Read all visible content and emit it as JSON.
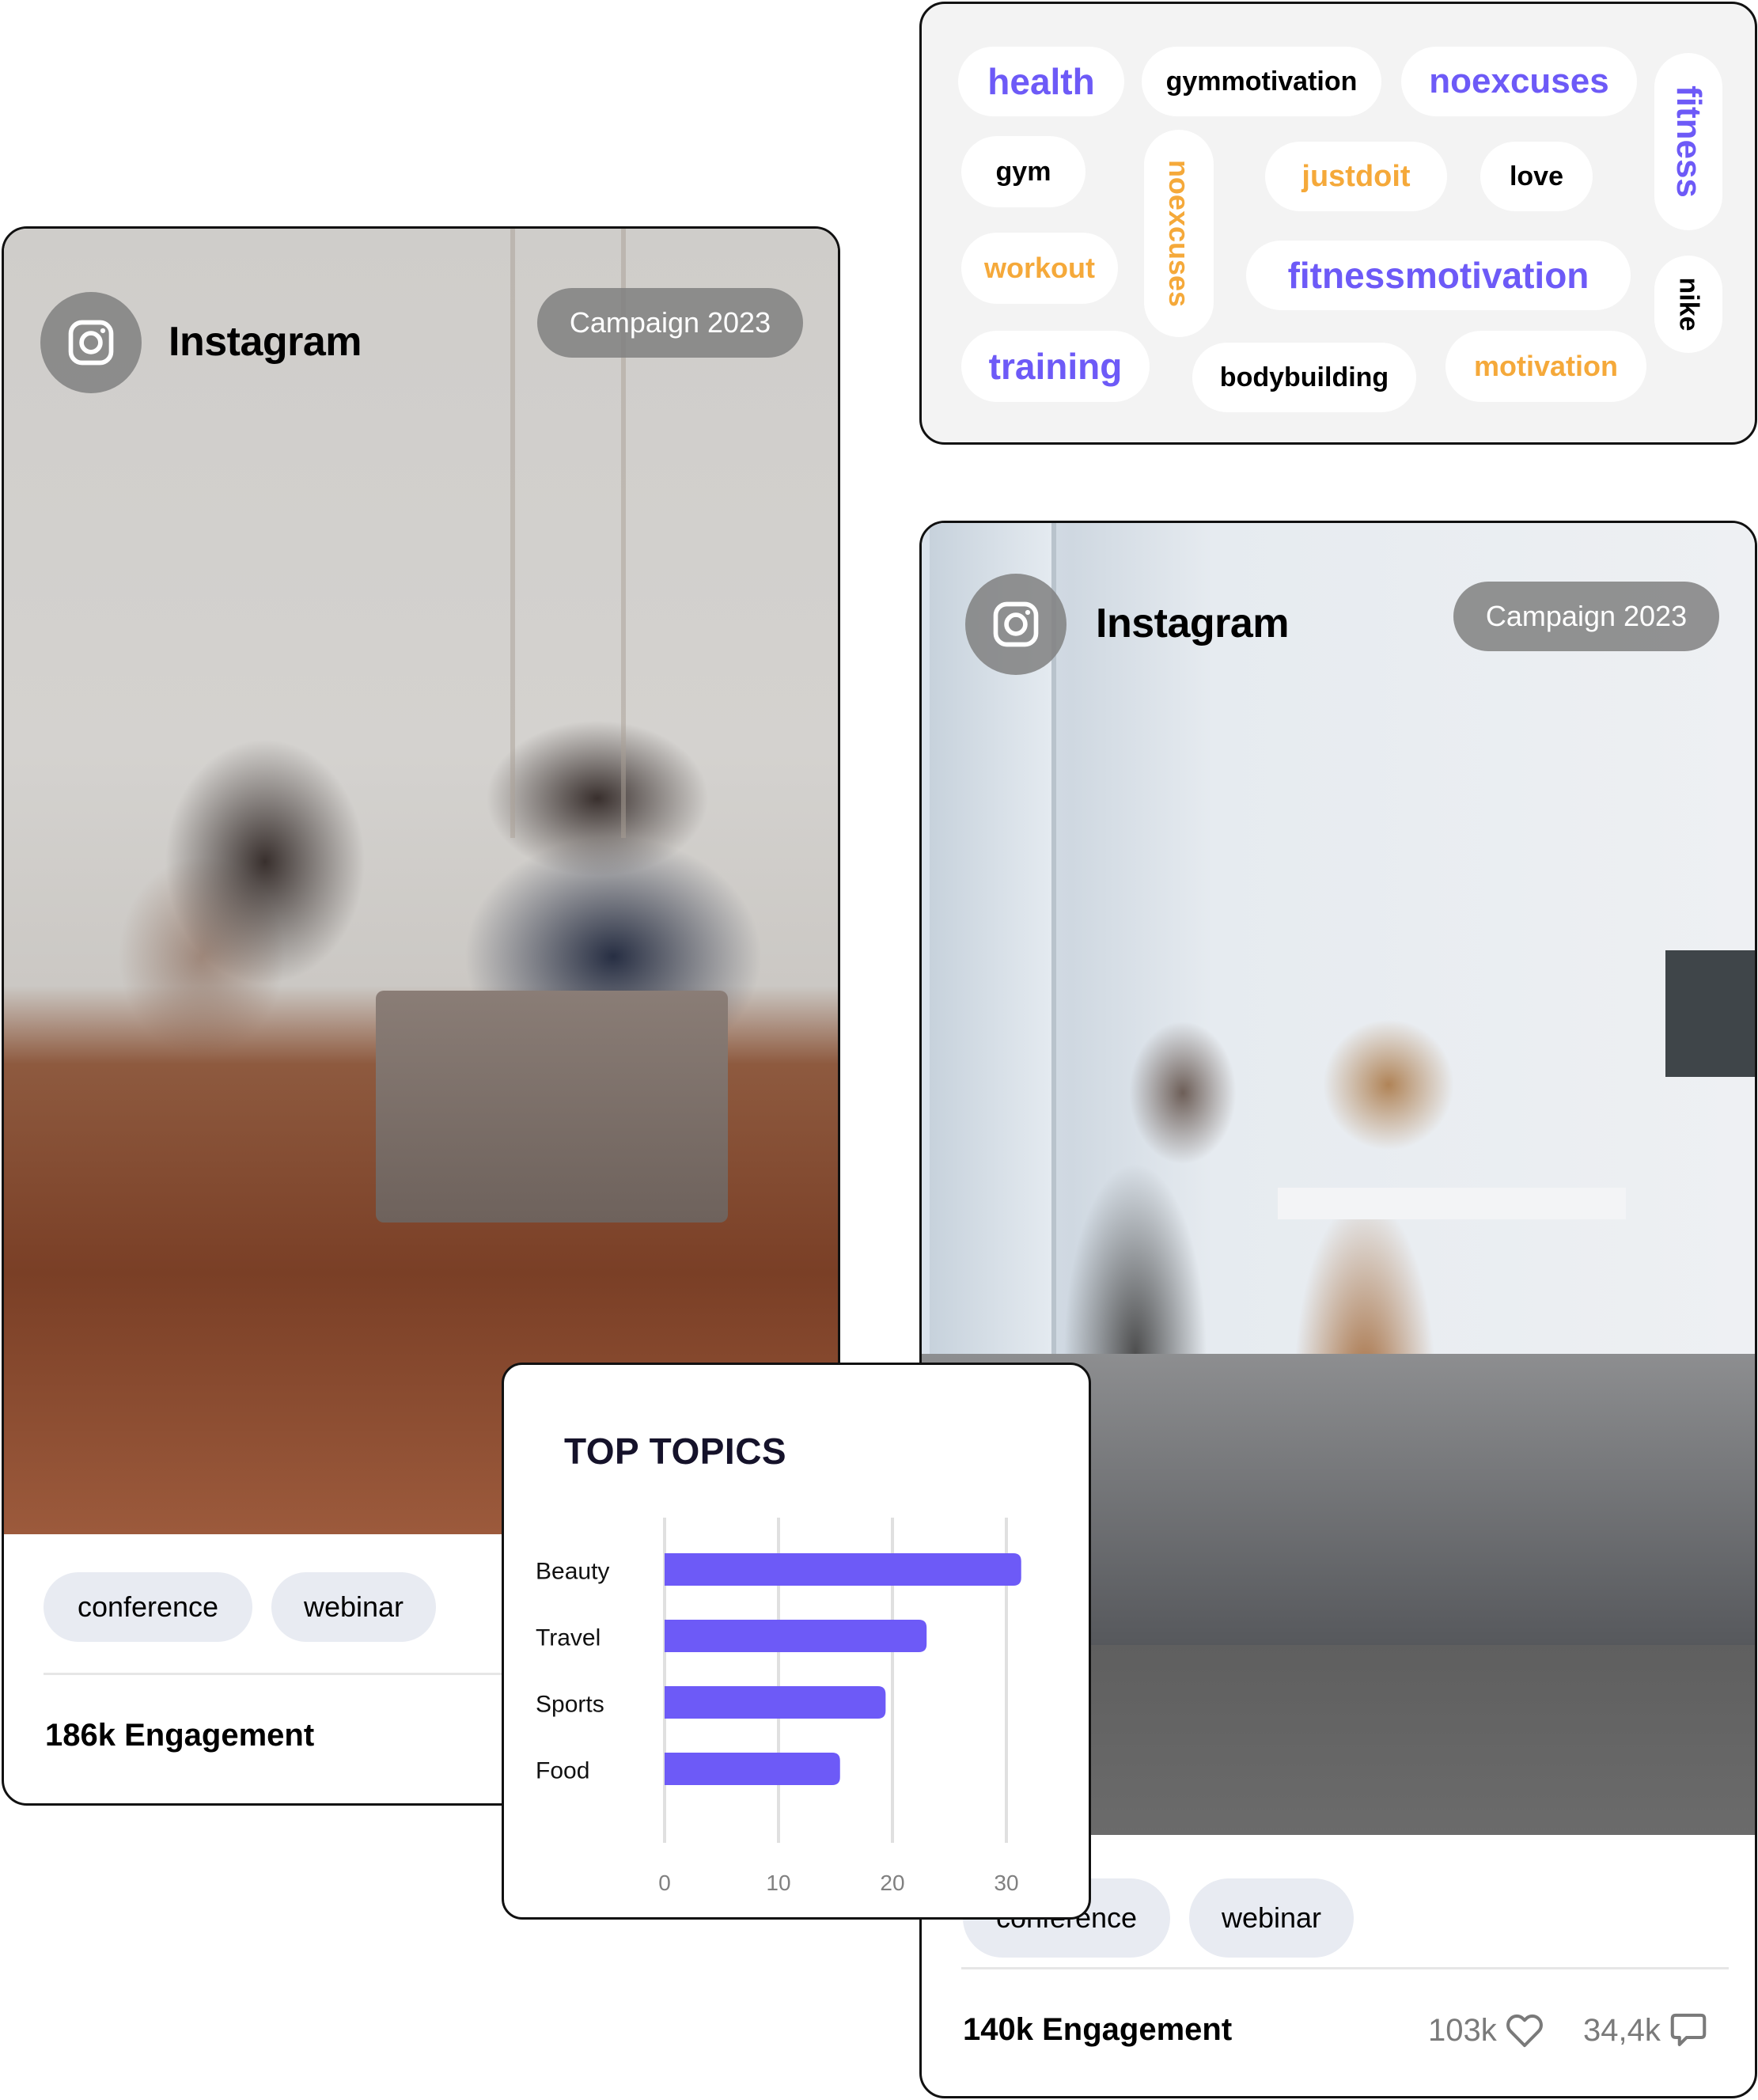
{
  "word_cloud": {
    "tags": [
      {
        "text": "health",
        "color": "purple",
        "orientation": "horizontal"
      },
      {
        "text": "gymmotivation",
        "color": "black",
        "orientation": "horizontal"
      },
      {
        "text": "noexcuses",
        "color": "purple",
        "orientation": "horizontal"
      },
      {
        "text": "fitness",
        "color": "purple",
        "orientation": "vertical"
      },
      {
        "text": "gym",
        "color": "black",
        "orientation": "horizontal"
      },
      {
        "text": "noexcuses",
        "color": "orange",
        "orientation": "vertical"
      },
      {
        "text": "justdoit",
        "color": "orange",
        "orientation": "horizontal"
      },
      {
        "text": "love",
        "color": "black",
        "orientation": "horizontal"
      },
      {
        "text": "workout",
        "color": "orange",
        "orientation": "horizontal"
      },
      {
        "text": "fitnessmotivation",
        "color": "purple",
        "orientation": "horizontal"
      },
      {
        "text": "nike",
        "color": "black",
        "orientation": "vertical"
      },
      {
        "text": "training",
        "color": "purple",
        "orientation": "horizontal"
      },
      {
        "text": "bodybuilding",
        "color": "black",
        "orientation": "horizontal"
      },
      {
        "text": "motivation",
        "color": "orange",
        "orientation": "horizontal"
      }
    ],
    "colors": {
      "purple": "#6d5af7",
      "orange": "#f5a93a",
      "black": "#000000"
    }
  },
  "post_left": {
    "platform": "Instagram",
    "platform_icon": "instagram-icon",
    "campaign": "Campaign 2023",
    "chips": [
      "conference",
      "webinar"
    ],
    "engagement": "186k Engagement"
  },
  "post_right": {
    "platform": "Instagram",
    "platform_icon": "instagram-icon",
    "campaign": "Campaign 2023",
    "chips": [
      "conference",
      "webinar"
    ],
    "engagement": "140k Engagement",
    "likes": "103k",
    "likes_icon": "heart-icon",
    "comments": "34,4k",
    "comments_icon": "comment-icon"
  },
  "chart_data": {
    "type": "bar",
    "orientation": "horizontal",
    "title": "TOP TOPICS",
    "categories": [
      "Beauty",
      "Travel",
      "Sports",
      "Food"
    ],
    "values": [
      31.3,
      23,
      19.4,
      15.4
    ],
    "xlabel": "",
    "ylabel": "",
    "xlim": [
      0,
      30
    ],
    "x_ticks": [
      0,
      10,
      20,
      30
    ],
    "x_tick_labels": [
      "0",
      "10",
      "20",
      "30"
    ],
    "grid": true,
    "legend": "none",
    "bar_color": "#6d5af7"
  }
}
